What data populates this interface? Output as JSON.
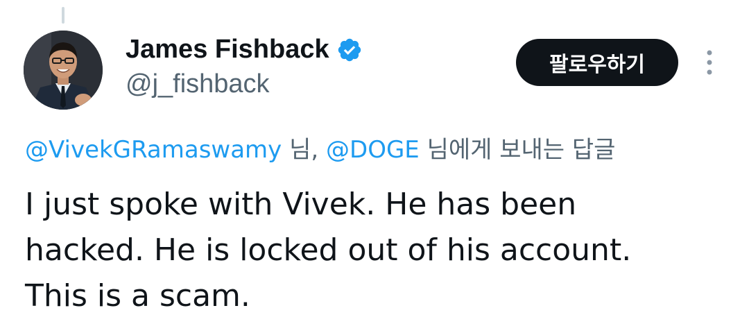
{
  "tweet": {
    "author": {
      "display_name": "James Fishback",
      "handle": "@j_fishback",
      "verified": true
    },
    "follow_label": "팔로우하기",
    "reply_context": {
      "mention_1": "@VivekGRamaswamy",
      "suffix_1": " 님, ",
      "mention_2": "@DOGE",
      "suffix_2": " 님에게 보내는 답글"
    },
    "text_lines": [
      "I just spoke with Vivek. He has been",
      "hacked. He is locked out of his account.",
      "This is a scam."
    ]
  },
  "colors": {
    "accent": "#1d9bf0",
    "text": "#0f1419",
    "secondary": "#536471",
    "button_bg": "#0f1419"
  },
  "icons": {
    "verified": "verified-badge-icon",
    "more": "more-vertical-icon"
  }
}
